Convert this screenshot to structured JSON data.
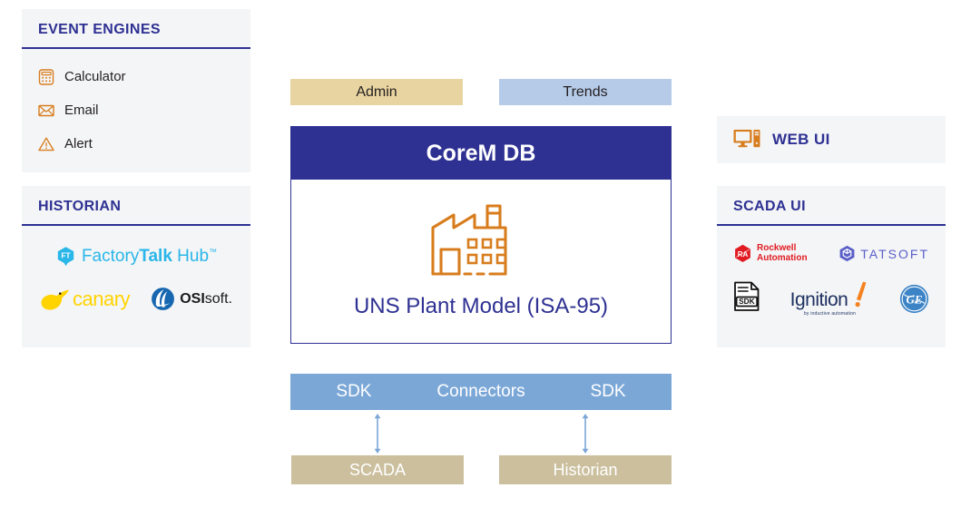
{
  "colors": {
    "navy": "#2e3192",
    "orange": "#d87d1e",
    "panel_bg": "#f4f5f7",
    "tab_admin_bg": "#e8d4a0",
    "tab_trends_bg": "#b6cbe8",
    "connectors_bg": "#7ba7d7",
    "bottom_box_bg": "#cbbf9e",
    "arrow": "#7ba7d7",
    "white": "#ffffff"
  },
  "event_engines": {
    "title": "EVENT ENGINES",
    "items": [
      {
        "label": "Calculator",
        "icon": "calculator-icon"
      },
      {
        "label": "Email",
        "icon": "envelope-icon"
      },
      {
        "label": "Alert",
        "icon": "warning-triangle-icon"
      }
    ]
  },
  "historian": {
    "title": "HISTORIAN",
    "logos": [
      {
        "name": "factorytalk-hub-logo",
        "text_1": "Factory",
        "text_2": "Talk",
        "text_3": " Hub",
        "tm": "™"
      },
      {
        "name": "canary-logo",
        "text": "canary"
      },
      {
        "name": "osisoft-logo",
        "text_1": "OSI",
        "text_2": "soft."
      }
    ]
  },
  "center": {
    "tabs": [
      {
        "label": "Admin",
        "name": "tab-admin"
      },
      {
        "label": "Trends",
        "name": "tab-trends"
      }
    ],
    "corem_title": "CoreM DB",
    "plant_model_label": "UNS Plant Model (ISA-95)",
    "plant_icon": "factory-icon",
    "connectors": {
      "left_label": "SDK",
      "mid_label": "Connectors",
      "right_label": "SDK"
    },
    "sources": [
      {
        "label": "SCADA",
        "name": "bottom-box-scada"
      },
      {
        "label": "Historian",
        "name": "bottom-box-historian"
      }
    ]
  },
  "web_ui": {
    "title": "WEB UI",
    "icon": "monitor-desktop-icon"
  },
  "scada_ui": {
    "title": "SCADA UI",
    "logos": [
      {
        "name": "rockwell-automation-logo",
        "badge": "RA",
        "text_1": "Rockwell",
        "text_2": "Automation"
      },
      {
        "name": "tatsoft-logo",
        "text": "TATSOFT"
      },
      {
        "name": "sdk-document-logo",
        "text": "SDK"
      },
      {
        "name": "ignition-logo",
        "text": "Ignition",
        "tagline": "by inductive automation"
      },
      {
        "name": "ge-logo",
        "text": "GE"
      }
    ]
  }
}
